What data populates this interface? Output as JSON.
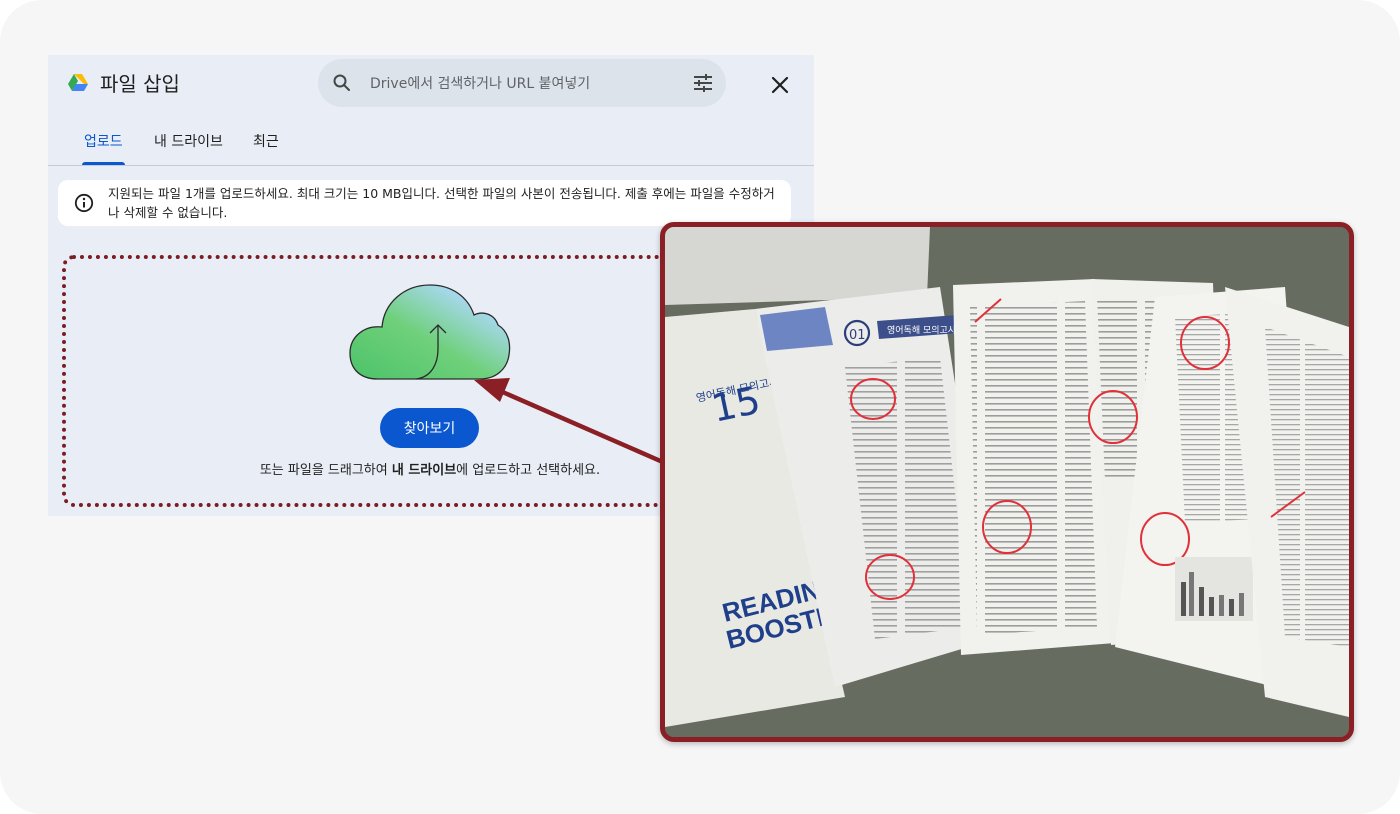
{
  "dialog": {
    "title": "파일 삽입",
    "search_placeholder": "Drive에서 검색하거나 URL 붙여넣기",
    "tabs": [
      {
        "label": "업로드",
        "active": true
      },
      {
        "label": "내 드라이브",
        "active": false
      },
      {
        "label": "최근",
        "active": false
      }
    ],
    "notice_text": "지원되는 파일 1개를 업로드하세요. 최대 크기는 10 MB입니다. 선택한 파일의 사본이 전송됩니다. 제출 후에는 파일을 수정하거나 삭제할 수 없습니다.",
    "browse_button": "찾아보기",
    "drop_hint_before": "또는 파일을 드래그하여 ",
    "drop_hint_bold": "내 드라이브",
    "drop_hint_after": "에 업로드하고 선택하세요."
  },
  "photo": {
    "cover_title": "영어독해 모의고사",
    "cover_number": "15",
    "cover_brand_line1": "READING",
    "cover_brand_line2": "BOOSTER",
    "page_badge": "01",
    "page_heading": "영어독해 모의고사"
  },
  "colors": {
    "accent_blue": "#0b57d0",
    "highlight_frame": "#8a1f25",
    "dialog_bg": "#e9eef6",
    "circle_marks": "#e0303a"
  },
  "icons": [
    "drive-logo-icon",
    "search-icon",
    "tune-icon",
    "close-icon",
    "info-icon",
    "cloud-upload-icon"
  ]
}
